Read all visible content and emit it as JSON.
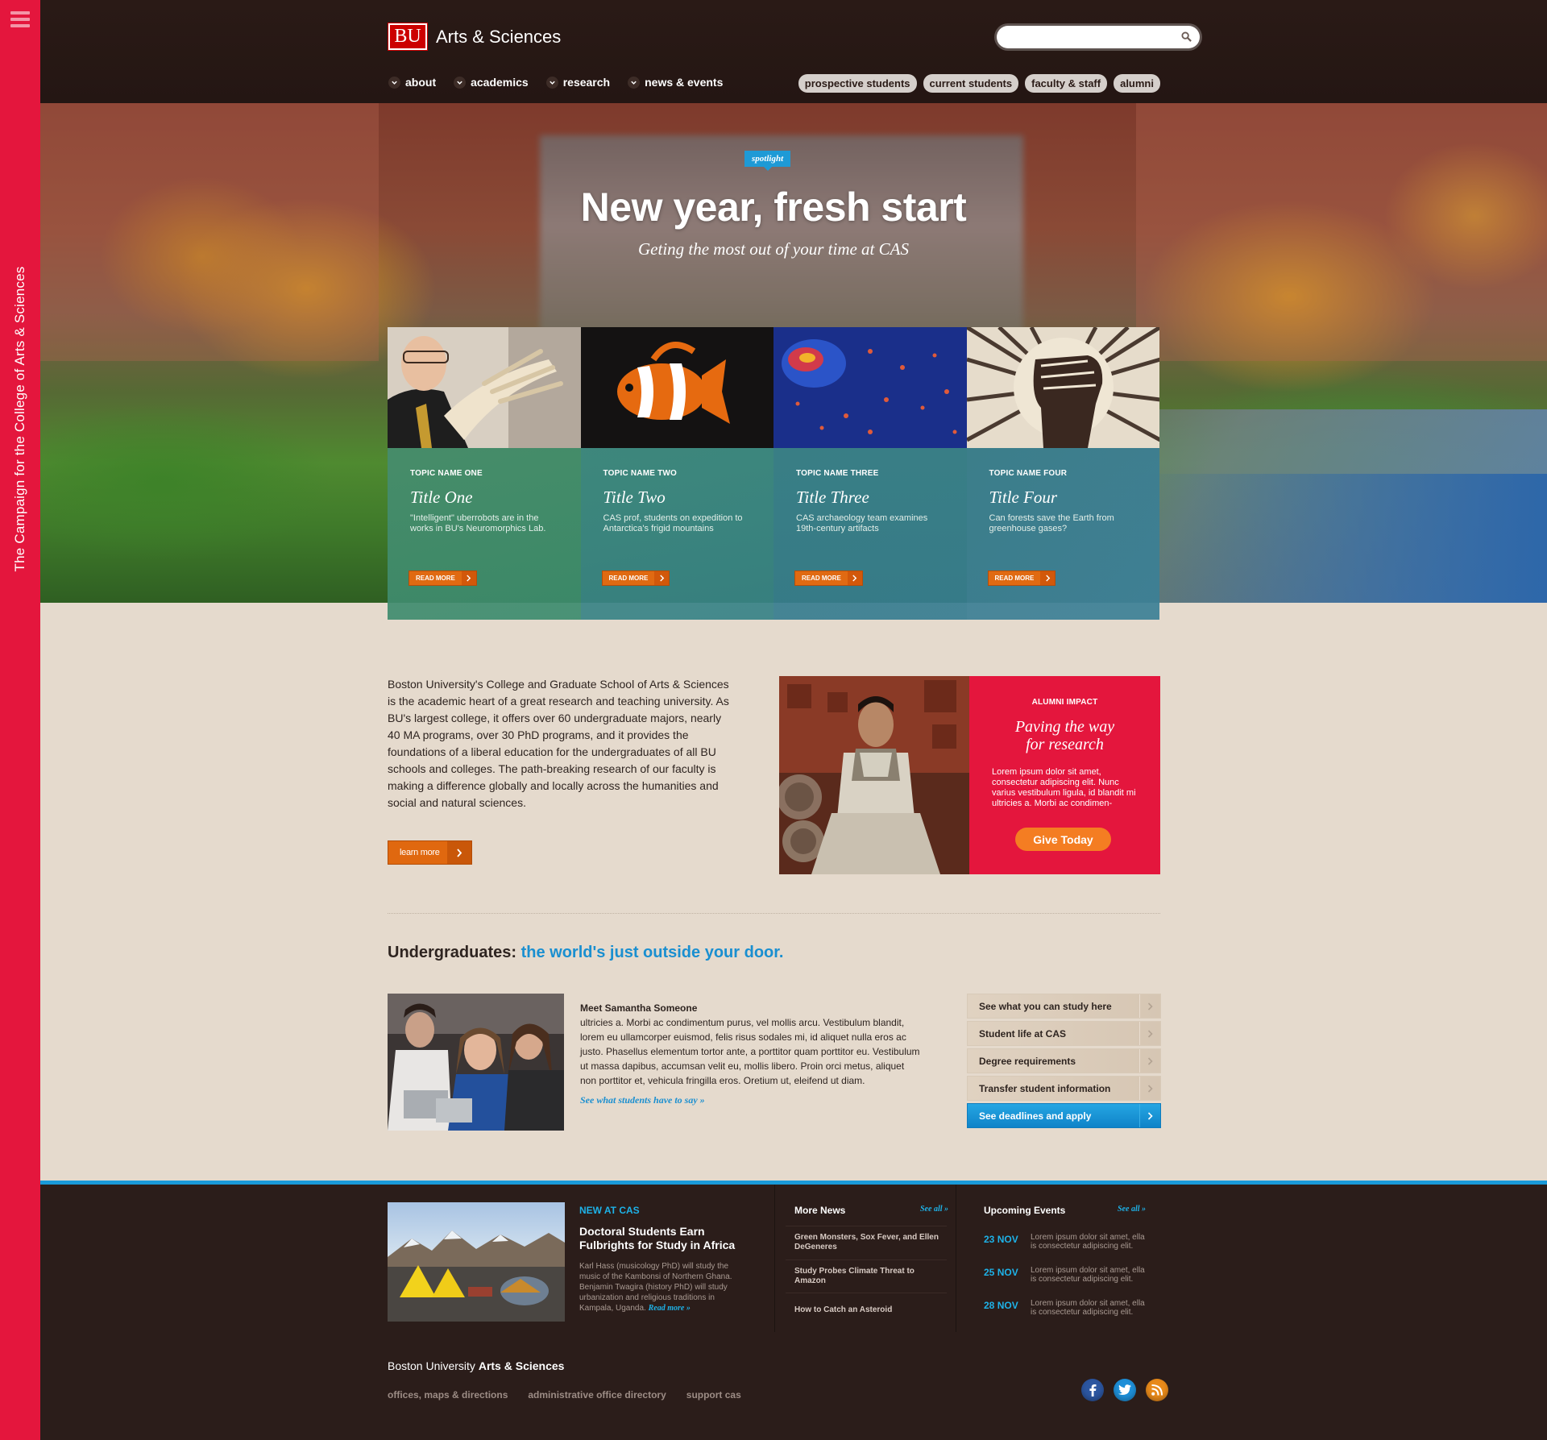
{
  "rail": {
    "text": "The Campaign for the College of Arts & Sciences"
  },
  "header": {
    "logo_mark": "BU",
    "site_name": "Arts & Sciences",
    "search_placeholder": "",
    "main_nav": [
      {
        "label": "about"
      },
      {
        "label": "academics"
      },
      {
        "label": "research"
      },
      {
        "label": "news & events"
      }
    ],
    "audience_nav": [
      {
        "label": "prospective students"
      },
      {
        "label": "current students"
      },
      {
        "label": "faculty & staff"
      },
      {
        "label": "alumni"
      }
    ]
  },
  "hero": {
    "badge": "spotlight",
    "title": "New year, fresh start",
    "subtitle": "Geting the most out of your time at CAS"
  },
  "cards": [
    {
      "topic": "TOPIC NAME ONE",
      "title": "Title One",
      "desc": "\"Intelligent\" uberrobots are in the works in BU's Neuromorphics Lab.",
      "button": "READ MORE"
    },
    {
      "topic": "TOPIC NAME TWO",
      "title": "Title Two",
      "desc": "CAS prof, students on expedition to Antarctica's frigid mountains",
      "button": "READ MORE"
    },
    {
      "topic": "TOPIC NAME THREE",
      "title": "Title Three",
      "desc": "CAS archaeology team examines 19th-century artifacts",
      "button": "READ MORE"
    },
    {
      "topic": "TOPIC NAME FOUR",
      "title": "Title Four",
      "desc": "Can forests save the Earth from greenhouse gases?",
      "button": "READ MORE"
    }
  ],
  "intro": {
    "text": "Boston University's College and Graduate School of Arts & Sciences is the academic heart of a great research and teaching university. As BU's largest college, it offers over 60 undergraduate majors, nearly 40 MA programs, over 30 PhD programs, and it provides the foundations of a liberal education for the undergraduates of all BU schools and colleges. The path-breaking research of our faculty is making a difference globally and locally across the humanities and social and natural sciences.",
    "button": "learn more"
  },
  "alumni": {
    "label": "ALUMNI IMPACT",
    "title_line1": "Paving the way",
    "title_line2": "for research",
    "text": "Lorem ipsum dolor sit amet, consectetur adipiscing elit. Nunc varius vestibulum ligula, id blandit mi ultricies a. Morbi ac condimen-",
    "button": "Give Today"
  },
  "undergrad": {
    "heading_a": "Undergraduates:",
    "heading_b": "the world's just outside your door.",
    "name": "Meet Samantha Someone",
    "body": "ultricies a. Morbi ac condimentum purus, vel mollis arcu. Vestibulum blandit, lorem eu ullamcorper euismod, felis risus sodales mi, id aliquet nulla eros ac justo. Phasellus elementum tortor ante, a porttitor quam porttitor eu. Vestibulum ut massa dapibus, accumsan velit eu, mollis libero. Proin orci metus, aliquet non porttitor et, vehicula fringilla eros.  Oretium ut, eleifend ut diam.",
    "link": "See what students have to say »",
    "list": [
      {
        "label": "See what you can study here"
      },
      {
        "label": "Student life at CAS"
      },
      {
        "label": "Degree requirements"
      },
      {
        "label": "Transfer student information"
      },
      {
        "label": "See deadlines and apply"
      }
    ]
  },
  "footer": {
    "new_at_a": "NEW",
    "new_at_b": "AT CAS",
    "feature_title": "Doctoral Students Earn Fulbrights for Study in Africa",
    "feature_desc": "Karl Hass (musicology PhD) will study the music of the Kambonsi of Northern Ghana. Benjamin Twagira (history PhD) will study urbanization and religious traditions in Kampala, Uganda.",
    "feature_link": "Read more »",
    "news_head": "More News",
    "news_see_all": "See all »",
    "news": [
      {
        "title": "Green Monsters, Sox Fever, and Ellen DeGeneres"
      },
      {
        "title": "Study Probes Climate Threat to Amazon"
      },
      {
        "title": "How to Catch an Asteroid"
      }
    ],
    "events_head": "Upcoming Events",
    "events_see_all": "See all »",
    "events": [
      {
        "day": "23",
        "month": "NOV",
        "text": "Lorem ipsum dolor sit amet, ella is consectetur adipiscing elit."
      },
      {
        "day": "25",
        "month": "NOV",
        "text": "Lorem ipsum dolor sit amet, ella is consectetur adipiscing elit."
      },
      {
        "day": "28",
        "month": "NOV",
        "text": "Lorem ipsum dolor sit amet, ella is consectetur adipiscing elit."
      }
    ],
    "name_a": "Boston University",
    "name_b": "Arts & Sciences",
    "links": [
      {
        "label": "offices, maps & directions"
      },
      {
        "label": "administrative office directory"
      },
      {
        "label": "support cas"
      }
    ],
    "social": [
      {
        "icon": "facebook-icon",
        "color": "#2c56a0"
      },
      {
        "icon": "twitter-icon",
        "color": "#1e8fd8"
      },
      {
        "icon": "rss-icon",
        "color": "#e88a1a"
      }
    ]
  }
}
